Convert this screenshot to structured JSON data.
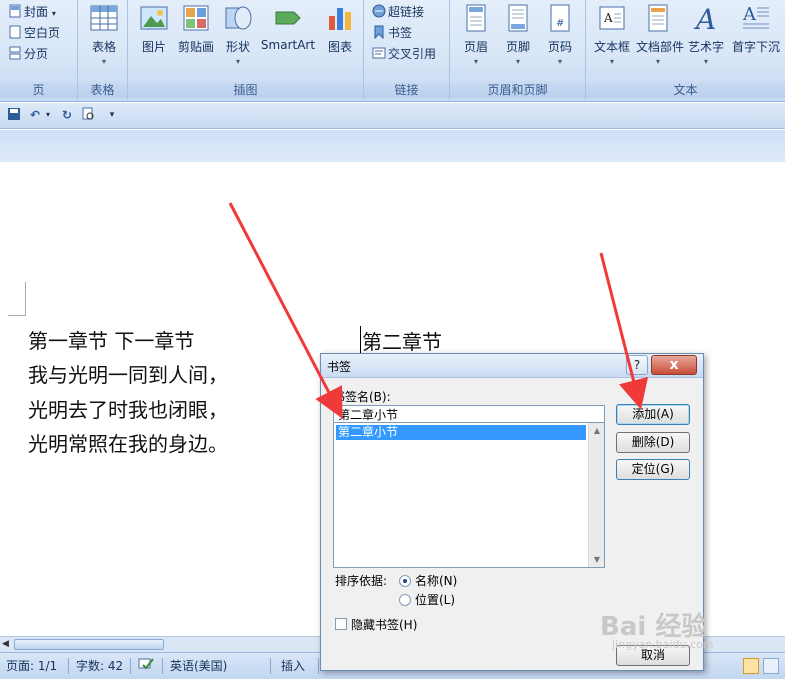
{
  "ribbon": {
    "page_group": {
      "label": "页",
      "items": [
        "封面",
        "空白页",
        "分页"
      ]
    },
    "table_group": {
      "label": "表格",
      "button": "表格"
    },
    "illustrations_group": {
      "label": "插图",
      "buttons": [
        "图片",
        "剪贴画",
        "形状",
        "SmartArt",
        "图表"
      ]
    },
    "links_group": {
      "label": "链接",
      "items": [
        "超链接",
        "书签",
        "交叉引用"
      ]
    },
    "header_footer_group": {
      "label": "页眉和页脚",
      "buttons": [
        "页眉",
        "页脚",
        "页码"
      ]
    },
    "text_group": {
      "label": "文本",
      "buttons": [
        "文本框",
        "文档部件",
        "艺术字",
        "首字下沉"
      ]
    }
  },
  "document": {
    "lines": [
      "第一章节  下一章节",
      "我与光明一同到人间，",
      "光明去了时我也闭眼，",
      "光明常照在我的身边。"
    ],
    "right_text": "第二章节"
  },
  "dialog": {
    "title": "书签",
    "help": "?",
    "close": "x",
    "name_label": "书签名(B):",
    "name_value": "第二章小节",
    "list_items": [
      "第二章小节"
    ],
    "add": "添加(A)",
    "delete": "删除(D)",
    "goto": "定位(G)",
    "sort_label": "排序依据:",
    "sort_options": [
      "名称(N)",
      "位置(L)"
    ],
    "sort_selected": "名称(N)",
    "hide_label": "隐藏书签(H)",
    "cancel": "取消"
  },
  "status": {
    "page": "页面: 1/1",
    "words": "字数: 42",
    "language": "英语(美国)",
    "mode": "插入"
  },
  "watermark": {
    "brand": "Bai 经验",
    "url": "jingyan.baidu.com"
  },
  "colors": {
    "ribbon_bg": "#dbe7f7",
    "selection": "#3399ff",
    "arrow": "#f03a3a"
  }
}
